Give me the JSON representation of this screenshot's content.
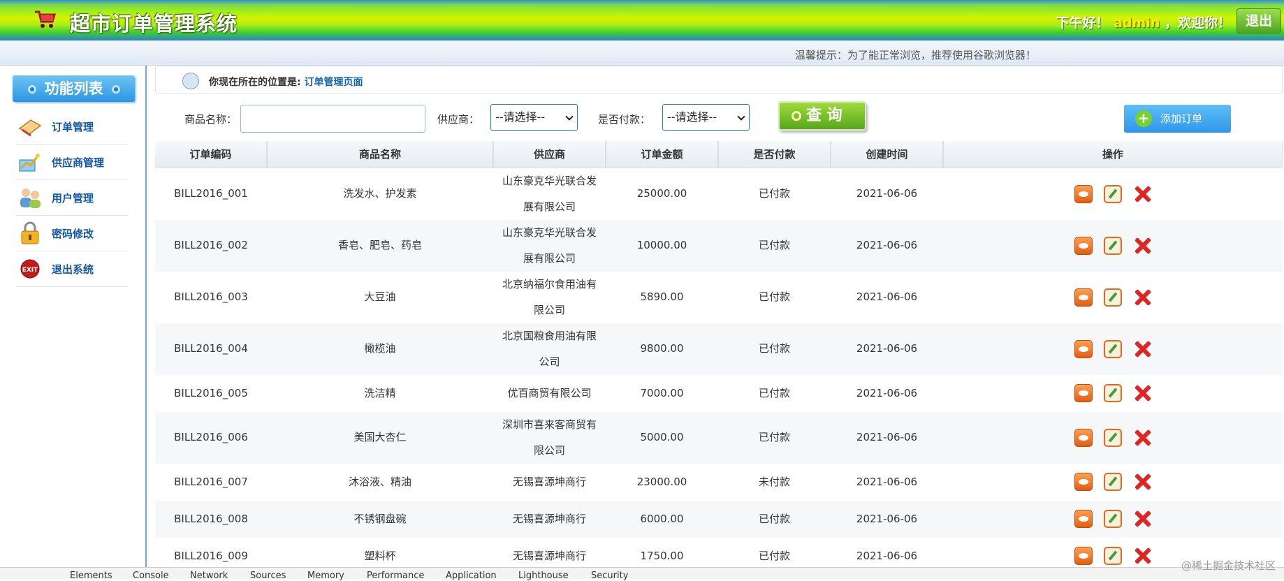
{
  "header": {
    "title": "超市订单管理系统",
    "greeting_prefix": "下午好！",
    "user": "admin",
    "greeting_suffix": "，欢迎你！",
    "logout_label": "退出"
  },
  "tip": "温馨提示：为了能正常浏览，推荐使用谷歌浏览器！",
  "sidebar": {
    "title": "功能列表",
    "items": [
      {
        "label": "订单管理",
        "icon": "order-icon"
      },
      {
        "label": "供应商管理",
        "icon": "supplier-icon"
      },
      {
        "label": "用户管理",
        "icon": "users-icon"
      },
      {
        "label": "密码修改",
        "icon": "lock-icon"
      },
      {
        "label": "退出系统",
        "icon": "exit-icon"
      }
    ]
  },
  "breadcrumb": {
    "label": "你现在所在的位置是:",
    "current": "订单管理页面"
  },
  "search": {
    "product_label": "商品名称：",
    "product_value": "",
    "supplier_label": "供应商：",
    "supplier_selected": "--请选择--",
    "paid_label": "是否付款：",
    "paid_selected": "--请选择--",
    "query_label": "查 询",
    "add_label": "添加订单"
  },
  "table": {
    "headers": [
      "订单编码",
      "商品名称",
      "供应商",
      "订单金额",
      "是否付款",
      "创建时间",
      "操作"
    ],
    "rows": [
      {
        "code": "BILL2016_001",
        "product": "洗发水、护发素",
        "supplier": "山东豪克华光联合发展有限公司",
        "amount": "25000.00",
        "paid": "已付款",
        "created": "2021-06-06"
      },
      {
        "code": "BILL2016_002",
        "product": "香皂、肥皂、药皂",
        "supplier": "山东豪克华光联合发展有限公司",
        "amount": "10000.00",
        "paid": "已付款",
        "created": "2021-06-06"
      },
      {
        "code": "BILL2016_003",
        "product": "大豆油",
        "supplier": "北京纳福尔食用油有限公司",
        "amount": "5890.00",
        "paid": "已付款",
        "created": "2021-06-06"
      },
      {
        "code": "BILL2016_004",
        "product": "橄榄油",
        "supplier": "北京国粮食用油有限公司",
        "amount": "9800.00",
        "paid": "已付款",
        "created": "2021-06-06"
      },
      {
        "code": "BILL2016_005",
        "product": "洗洁精",
        "supplier": "优百商贸有限公司",
        "amount": "7000.00",
        "paid": "已付款",
        "created": "2021-06-06"
      },
      {
        "code": "BILL2016_006",
        "product": "美国大杏仁",
        "supplier": "深圳市喜来客商贸有限公司",
        "amount": "5000.00",
        "paid": "已付款",
        "created": "2021-06-06"
      },
      {
        "code": "BILL2016_007",
        "product": "沐浴液、精油",
        "supplier": "无锡喜源坤商行",
        "amount": "23000.00",
        "paid": "未付款",
        "created": "2021-06-06"
      },
      {
        "code": "BILL2016_008",
        "product": "不锈钢盘碗",
        "supplier": "无锡喜源坤商行",
        "amount": "6000.00",
        "paid": "已付款",
        "created": "2021-06-06"
      },
      {
        "code": "BILL2016_009",
        "product": "塑料杯",
        "supplier": "无锡喜源坤商行",
        "amount": "1750.00",
        "paid": "已付款",
        "created": "2021-06-06"
      }
    ]
  },
  "devtools": {
    "tabs": [
      "Elements",
      "Console",
      "Network",
      "Sources",
      "Memory",
      "Performance",
      "Application",
      "Lighthouse",
      "Security"
    ],
    "watermark": "@稀土掘金技术社区"
  },
  "colors": {
    "accent": "#2f97e9",
    "link": "#1460b0",
    "delete": "#e02323"
  }
}
